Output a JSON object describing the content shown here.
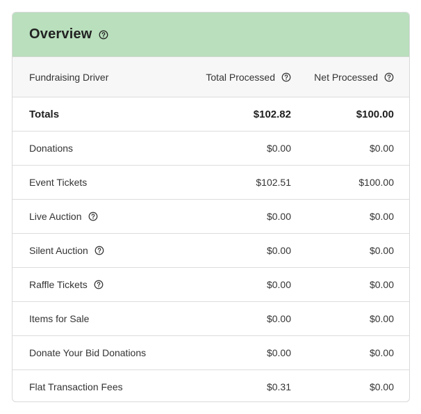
{
  "overview": {
    "title": "Overview"
  },
  "columns": {
    "driver": "Fundraising Driver",
    "total": "Total Processed",
    "net": "Net Processed"
  },
  "totals": {
    "label": "Totals",
    "total": "$102.82",
    "net": "$100.00"
  },
  "rows": [
    {
      "label": "Donations",
      "total": "$0.00",
      "net": "$0.00",
      "help": false
    },
    {
      "label": "Event Tickets",
      "total": "$102.51",
      "net": "$100.00",
      "help": false
    },
    {
      "label": "Live Auction",
      "total": "$0.00",
      "net": "$0.00",
      "help": true
    },
    {
      "label": "Silent Auction",
      "total": "$0.00",
      "net": "$0.00",
      "help": true
    },
    {
      "label": "Raffle Tickets",
      "total": "$0.00",
      "net": "$0.00",
      "help": true
    },
    {
      "label": "Items for Sale",
      "total": "$0.00",
      "net": "$0.00",
      "help": false
    },
    {
      "label": "Donate Your Bid Donations",
      "total": "$0.00",
      "net": "$0.00",
      "help": false
    },
    {
      "label": "Flat Transaction Fees",
      "total": "$0.31",
      "net": "$0.00",
      "help": false
    }
  ],
  "colors": {
    "header_bg": "#b9dfbc",
    "column_header_bg": "#f7f7f7",
    "border": "#dcdcdc"
  },
  "icons": {
    "help": "question-circle-icon"
  }
}
